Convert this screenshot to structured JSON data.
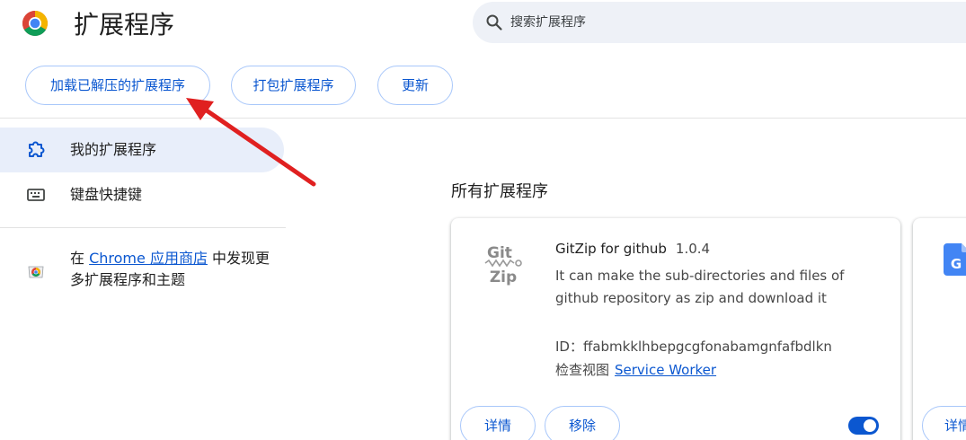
{
  "header": {
    "title": "扩展程序",
    "search_placeholder": "搜索扩展程序"
  },
  "toolbar": {
    "load_unpacked": "加载已解压的扩展程序",
    "pack": "打包扩展程序",
    "update": "更新"
  },
  "sidebar": {
    "items": [
      {
        "label": "我的扩展程序",
        "icon": "puzzle-icon",
        "active": true
      },
      {
        "label": "键盘快捷键",
        "icon": "keyboard-icon",
        "active": false
      }
    ],
    "webstore": {
      "prefix": "在 ",
      "link": "Chrome 应用商店",
      "suffix": " 中发现更多扩展程序和主题"
    }
  },
  "main": {
    "section_title": "所有扩展程序",
    "extensions": [
      {
        "name": "GitZip for github",
        "version": "1.0.4",
        "description": "It can make the sub-directories and files of github repository as zip and download it",
        "id_label": "ID：",
        "id": "ffabmkklhbepgcgfonabamgnfafbdlkn",
        "inspect_label": "检查视图",
        "inspect_link": "Service Worker",
        "details_label": "详情",
        "remove_label": "移除",
        "enabled": true
      },
      {
        "details_label": "详情"
      }
    ]
  },
  "colors": {
    "accent": "#0b57d0",
    "active_bg": "#e8eefa",
    "search_bg": "#eef1f7",
    "annotation": "#e02020"
  }
}
